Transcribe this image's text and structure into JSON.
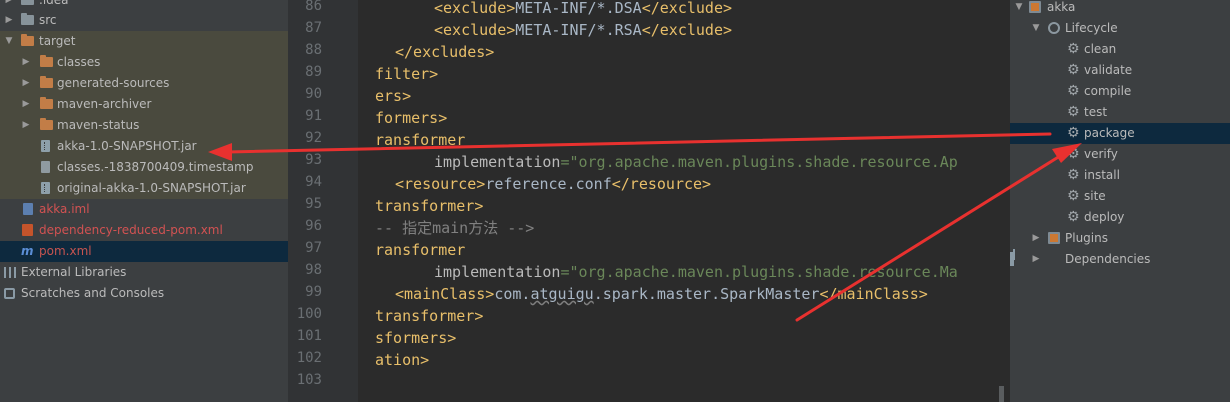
{
  "project_tree": {
    "idea": ".idea",
    "src": "src",
    "target": "target",
    "classes": "classes",
    "generated_sources": "generated-sources",
    "maven_archiver": "maven-archiver",
    "maven_status": "maven-status",
    "jar": "akka-1.0-SNAPSHOT.jar",
    "timestamp": "classes.-1838700409.timestamp",
    "original_jar": "original-akka-1.0-SNAPSHOT.jar",
    "iml": "akka.iml",
    "dep_pom": "dependency-reduced-pom.xml",
    "pom": "pom.xml",
    "mvn_icon": "m",
    "external_libraries": "External Libraries",
    "scratches": "Scratches and Consoles"
  },
  "editor": {
    "line_numbers": [
      "86",
      "87",
      "88",
      "89",
      "90",
      "91",
      "92",
      "93",
      "94",
      "95",
      "96",
      "97",
      "98",
      "99",
      "100",
      "101",
      "102",
      "103"
    ],
    "l86_text": "META-INF/*.DSA",
    "l87_text": "META-INF/*.RSA",
    "l89": "filter>",
    "l90": "ers>",
    "l91": "formers>",
    "l92": "ransformer",
    "l93_attr": "implementation",
    "l93_val": "=\"org.apache.maven.plugins.shade.resource.Ap",
    "l94_text": "reference.conf",
    "l95": "transformer>",
    "l96": "-- 指定main方法 -->",
    "l97": "ransformer",
    "l98_attr": "implementation",
    "l98_val": "=\"org.apache.maven.plugins.shade.resource.Ma",
    "l99_pre": "com.",
    "l99_wavy": "atguigu",
    "l99_post": ".spark.master.SparkMaster",
    "l100": "transformer>",
    "l101": "sformers>",
    "l102": "ation>",
    "tag_exclude_open": "<exclude>",
    "tag_exclude_close": "</exclude>",
    "tag_excludes_close": "</excludes>",
    "tag_resource_open": "<resource>",
    "tag_resource_close": "</resource>",
    "tag_mainclass_open": "<mainClass>",
    "tag_mainclass_close": "</mainClass>"
  },
  "maven": {
    "project": "akka",
    "lifecycle": "Lifecycle",
    "goals": [
      "clean",
      "validate",
      "compile",
      "test",
      "package",
      "verify",
      "install",
      "site",
      "deploy"
    ],
    "plugins": "Plugins",
    "dependencies": "Dependencies",
    "selected_goal": "package"
  },
  "colors": {
    "annotation_arrow": "#e8312f",
    "selection": "#0d293e"
  }
}
